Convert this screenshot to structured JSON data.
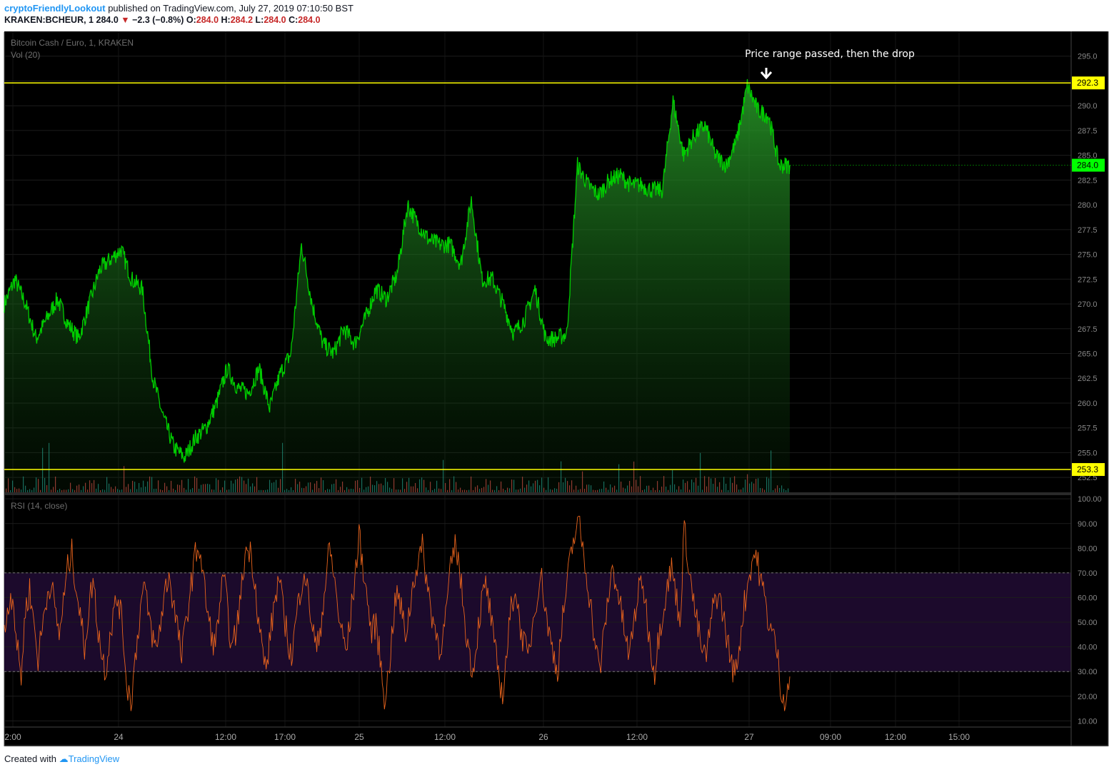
{
  "header": {
    "author": "cryptoFriendlyLookout",
    "published_text": "published on TradingView.com, July 27, 2019 07:10:50 BST",
    "symbol": "KRAKEN:BCHEUR, 1",
    "last": "284.0",
    "change": "−2.3 (−0.8%)",
    "o_label": "O:",
    "o": "284.0",
    "h_label": "H:",
    "h": "284.2",
    "l_label": "L:",
    "l": "284.0",
    "c_label": "C:",
    "c": "284.0"
  },
  "footer": {
    "created_with": "Created with",
    "brand": "TradingView"
  },
  "colors": {
    "background": "#000000",
    "price_line": "#00cc00",
    "horizontal_line": "#ffff00",
    "last_price_label": "#00ff00",
    "rsi_line": "#e8631c",
    "rsi_band": "#1c0a2c",
    "volume_up": "#26a69a",
    "volume_down": "#ef5350"
  },
  "chart_data": {
    "type": "area",
    "title": "Bitcoin Cash / Euro, 1, KRAKEN",
    "volume_label": "Vol (20)",
    "annotation": "Price range passed, then the drop",
    "grid": true,
    "y_axis_side": "right",
    "ylim": [
      251,
      297.5
    ],
    "y_ticks": [
      "295.0",
      "292.5",
      "290.0",
      "287.5",
      "285.0",
      "282.5",
      "280.0",
      "277.5",
      "275.0",
      "272.5",
      "270.0",
      "267.5",
      "265.0",
      "262.5",
      "260.0",
      "257.5",
      "255.0",
      "252.5"
    ],
    "horizontal_lines": [
      {
        "value": 292.3,
        "label": "292.3"
      },
      {
        "value": 253.3,
        "label": "253.3"
      }
    ],
    "last_price": {
      "value": 284.0,
      "label": "284.0"
    },
    "x_ticks": [
      "2:00",
      "24",
      "12:00",
      "17:00",
      "25",
      "12:00",
      "26",
      "12:00",
      "27",
      "09:00",
      "12:00",
      "15:00"
    ],
    "price_series": {
      "x": [
        0,
        2,
        4,
        6,
        8,
        10,
        12,
        14,
        16,
        18,
        20,
        22,
        24,
        26,
        28,
        30,
        32,
        34,
        36,
        38,
        40,
        42,
        44,
        46,
        48,
        50,
        52,
        54,
        56,
        58,
        60,
        62,
        64,
        66,
        68,
        70,
        72,
        74,
        76,
        78,
        80,
        82,
        84,
        86,
        88,
        90,
        92,
        94,
        96,
        98,
        100,
        102,
        104,
        106,
        108,
        110,
        112,
        114,
        116,
        118,
        120,
        122,
        124,
        126,
        128,
        130,
        132,
        134,
        136,
        138,
        140,
        142,
        144,
        146,
        148,
        150,
        152,
        154,
        156,
        158,
        160,
        162,
        164,
        166,
        168,
        170,
        172,
        174,
        176,
        178,
        180,
        182,
        184,
        186,
        188,
        190,
        192,
        194,
        196,
        198,
        200
      ],
      "values": [
        270.0,
        272.5,
        270.0,
        266.5,
        268.5,
        270.5,
        268.0,
        266.5,
        270.0,
        273.5,
        274.5,
        275.5,
        272.5,
        271.5,
        262.5,
        258.5,
        255.5,
        254.5,
        256.5,
        257.5,
        260.0,
        263.5,
        261.5,
        261.0,
        263.5,
        259.5,
        263.0,
        265.0,
        276.0,
        270.0,
        266.0,
        265.0,
        267.5,
        266.0,
        268.5,
        271.5,
        270.5,
        273.0,
        280.0,
        278.0,
        276.5,
        276.0,
        276.0,
        274.0,
        280.5,
        272.5,
        272.5,
        270.0,
        267.0,
        268.5,
        271.5,
        266.5,
        266.5,
        267.0,
        284.0,
        282.0,
        281.0,
        282.5,
        283.0,
        282.0,
        282.0,
        281.5,
        281.5,
        290.5,
        285.0,
        287.0,
        288.0,
        285.0,
        284.0,
        286.5,
        292.0,
        289.5,
        289.0,
        284.0,
        284.0
      ]
    },
    "rsi": {
      "label": "RSI (14, close)",
      "ylim": [
        7.5,
        101.5
      ],
      "y_ticks": [
        "100.00",
        "90.00",
        "80.00",
        "70.00",
        "60.00",
        "50.00",
        "40.00",
        "30.00",
        "20.00",
        "10.00"
      ],
      "band": [
        30,
        70
      ],
      "values": [
        45,
        58,
        62,
        40,
        28,
        55,
        63,
        50,
        35,
        48,
        60,
        67,
        55,
        45,
        58,
        72,
        78,
        65,
        52,
        40,
        55,
        68,
        50,
        38,
        30,
        45,
        55,
        60,
        48,
        25,
        18,
        35,
        52,
        65,
        55,
        45,
        38,
        50,
        62,
        70,
        58,
        48,
        35,
        50,
        62,
        75,
        82,
        70,
        55,
        45,
        40,
        58,
        68,
        52,
        38,
        48,
        60,
        78,
        80,
        72,
        55,
        40,
        30,
        45,
        58,
        68,
        55,
        45,
        35,
        50,
        62,
        72,
        60,
        48,
        38,
        50,
        65,
        80,
        70,
        55,
        45,
        38,
        52,
        68,
        85,
        72,
        58,
        45,
        50,
        35,
        20,
        28,
        50,
        62,
        55,
        45,
        55,
        68,
        75,
        80,
        68,
        55,
        48,
        40,
        45,
        60,
        75,
        82,
        68,
        52,
        38,
        30,
        45,
        58,
        65,
        55,
        40,
        30,
        20,
        38,
        55,
        65,
        50,
        42,
        35,
        48,
        60,
        70,
        58,
        45,
        38,
        30,
        48,
        62,
        75,
        85,
        92,
        80,
        68,
        55,
        40,
        30,
        45,
        60,
        72,
        65,
        55,
        45,
        35,
        50,
        60,
        68,
        55,
        40,
        30,
        45,
        55,
        65,
        72,
        62,
        50,
        88,
        75,
        60,
        50,
        40,
        35,
        45,
        58,
        62,
        55,
        45,
        35,
        28,
        40,
        55,
        65,
        75,
        78,
        68,
        60,
        50,
        45,
        38,
        22,
        18,
        28
      ]
    }
  }
}
